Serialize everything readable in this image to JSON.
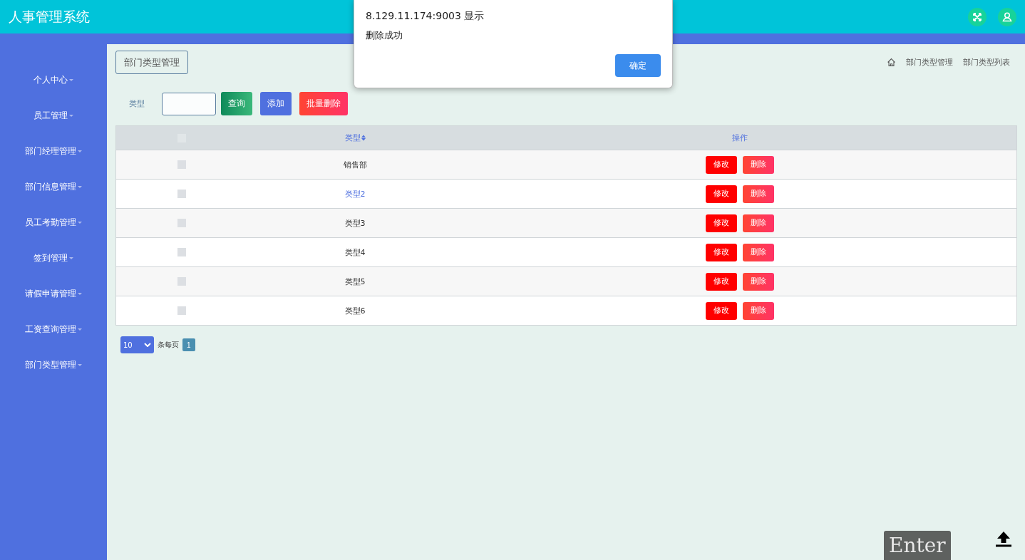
{
  "header": {
    "title": "人事管理系统"
  },
  "sidebar": {
    "items": [
      {
        "label": "个人中心"
      },
      {
        "label": "员工管理"
      },
      {
        "label": "部门经理管理"
      },
      {
        "label": "部门信息管理"
      },
      {
        "label": "员工考勤管理"
      },
      {
        "label": "签到管理"
      },
      {
        "label": "请假申请管理"
      },
      {
        "label": "工资查询管理"
      },
      {
        "label": "部门类型管理"
      }
    ]
  },
  "page_tag": "部门类型管理",
  "breadcrumb": [
    "部门类型管理",
    "部门类型列表"
  ],
  "search": {
    "label": "类型",
    "buttons": [
      {
        "kind": "query",
        "label": "查询"
      },
      {
        "kind": "add",
        "label": "添加"
      },
      {
        "kind": "batch_delete",
        "label": "批量删除"
      }
    ]
  },
  "table": {
    "header_checked": false,
    "columns": [
      "类型",
      "操作"
    ],
    "rows": [
      {
        "checked": false,
        "highlighted": false,
        "type": "销售部",
        "actions": [
          "修改",
          "删除"
        ]
      },
      {
        "checked": false,
        "highlighted": true,
        "type": "类型2",
        "actions": [
          "修改",
          "删除"
        ]
      },
      {
        "checked": false,
        "highlighted": false,
        "type": "类型3",
        "actions": [
          "修改",
          "删除"
        ]
      },
      {
        "checked": false,
        "highlighted": false,
        "type": "类型4",
        "actions": [
          "修改",
          "删除"
        ]
      },
      {
        "checked": false,
        "highlighted": false,
        "type": "类型5",
        "actions": [
          "修改",
          "删除"
        ]
      },
      {
        "checked": false,
        "highlighted": false,
        "type": "类型6",
        "actions": [
          "修改",
          "删除"
        ]
      }
    ]
  },
  "pagination": {
    "page_size": "10",
    "per_page_label": "条每页",
    "pages": [
      {
        "label": "1",
        "selected": true
      }
    ]
  },
  "dialog": {
    "title": "8.129.11.174:9003 显示",
    "message": "删除成功",
    "button": "确定"
  },
  "key_overlay": "Enter"
}
